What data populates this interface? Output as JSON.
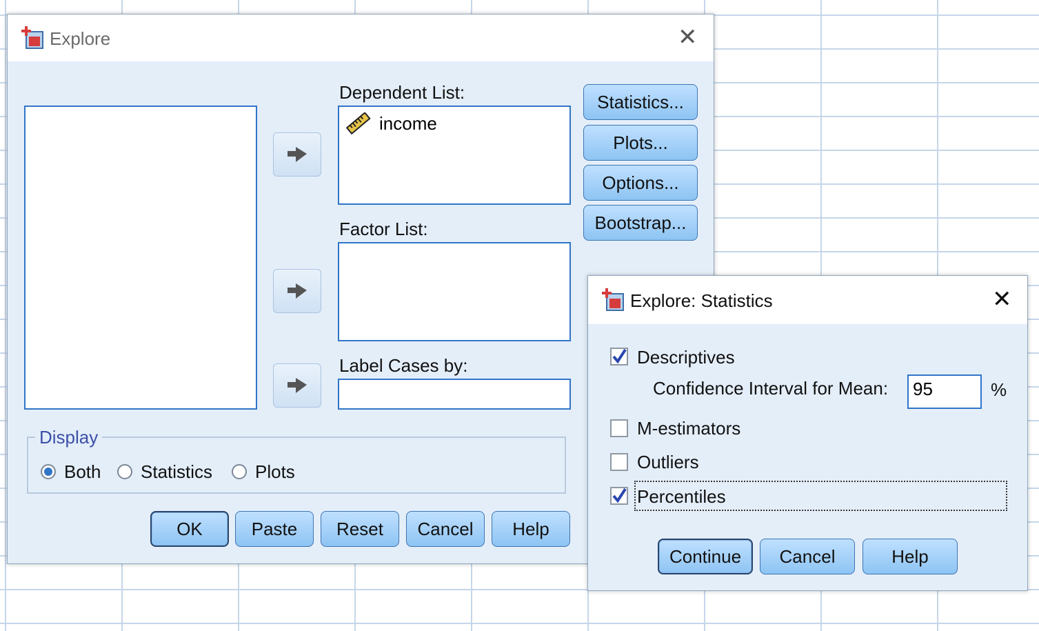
{
  "explore": {
    "title": "Explore",
    "dependent_label": "Dependent List:",
    "dependent_items": [
      {
        "name": "income",
        "icon": "ruler-scale-icon"
      }
    ],
    "factor_label": "Factor List:",
    "label_cases_label": "Label Cases by:",
    "side_buttons": [
      "Statistics...",
      "Plots...",
      "Options...",
      "Bootstrap..."
    ],
    "display": {
      "legend": "Display",
      "options": [
        "Both",
        "Statistics",
        "Plots"
      ],
      "selected": "Both"
    },
    "bottom_buttons": [
      "OK",
      "Paste",
      "Reset",
      "Cancel",
      "Help"
    ]
  },
  "stats": {
    "title": "Explore: Statistics",
    "descriptives": {
      "label": "Descriptives",
      "checked": true
    },
    "ci_label": "Confidence Interval for Mean:",
    "ci_value": "95",
    "ci_unit": "%",
    "m_estimators": {
      "label": "M-estimators",
      "checked": false
    },
    "outliers": {
      "label": "Outliers",
      "checked": false
    },
    "percentiles": {
      "label": "Percentiles",
      "checked": true
    },
    "buttons": [
      "Continue",
      "Cancel",
      "Help"
    ]
  },
  "colors": {
    "accent": "#2f75c8",
    "button": "#8ec4f3",
    "dialog_bg": "#e4eef9",
    "legend": "#3c4fa8"
  }
}
